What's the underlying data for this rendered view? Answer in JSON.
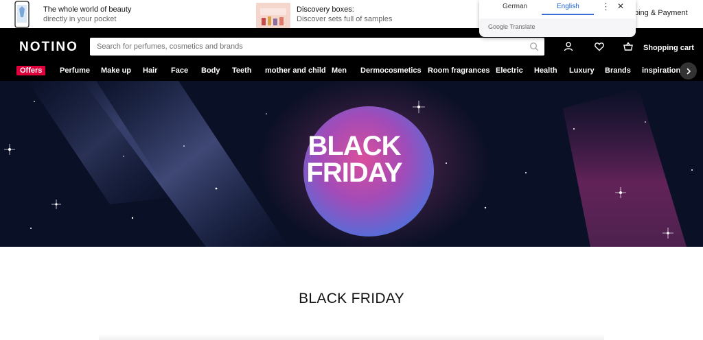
{
  "promo": {
    "app_title": "The whole world of beauty",
    "app_sub": "directly in your pocket",
    "box_title": "Discovery boxes:",
    "box_sub": "Discover sets full of samples",
    "shipping": "ping & Payment"
  },
  "header": {
    "logo": "NOTINO",
    "search_placeholder": "Search for perfumes, cosmetics and brands",
    "cart_label": "Shopping cart",
    "icons": [
      "search-icon",
      "user-icon",
      "heart-icon",
      "basket-icon"
    ]
  },
  "nav": {
    "items": [
      "Offers",
      "Perfume",
      "Make up",
      "Hair",
      "Face",
      "Body",
      "Teeth",
      "mother and child",
      "Men",
      "Dermocosmetics",
      "Room fragrances",
      "Electric",
      "Health",
      "Luxury",
      "Brands",
      "inspiration"
    ]
  },
  "hero": {
    "line1": "BLACK",
    "line2": "FRIDAY"
  },
  "section": {
    "title": "BLACK FRIDAY"
  },
  "translate": {
    "lang_from": "German",
    "lang_to": "English",
    "more": "⋮",
    "close": "✕",
    "brand": "Google Translate"
  },
  "colors": {
    "header_bg": "#000000",
    "offers_badge": "#e0003c",
    "hero_bg": "#0a1026",
    "translate_accent": "#1a5fd0"
  }
}
